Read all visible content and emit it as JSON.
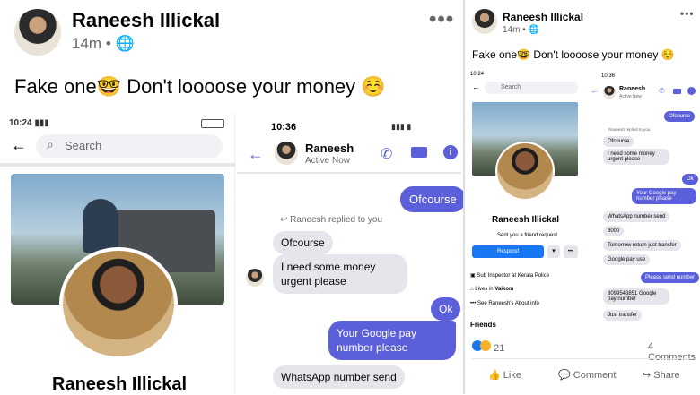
{
  "left_post": {
    "author": "Raneesh Illickal",
    "time": "14m",
    "caption": "Fake one",
    "caption_rest": "Don't loooose  your money",
    "emoji_nerd": "🤓",
    "emoji_smile": "☺️"
  },
  "left_phone_a": {
    "time": "10:24",
    "search_placeholder": "Search",
    "profile_name": "Raneesh Illickal"
  },
  "left_phone_b": {
    "time": "10:36",
    "contact_name": "Raneesh",
    "contact_status": "Active Now",
    "bubbles": {
      "ofcourse_out": "Ofcourse",
      "replied": "Raneesh replied to you",
      "ofcourse_in": "Ofcourse",
      "need_money": "I need some money urgent please",
      "ok": "Ok",
      "google_pay": "Your Google pay number please",
      "whatsapp": "WhatsApp number send"
    }
  },
  "right_post": {
    "author": "Raneesh Illickal",
    "time": "14m",
    "caption": "Fake one",
    "caption_rest": "Don't loooose  your money",
    "phone_a": {
      "time": "10:24",
      "search_placeholder": "Search",
      "profile_name": "Raneesh Illickal",
      "friend_request": "Sent you a friend request",
      "respond": "Respond",
      "work": "Sub Inspector at Kerala Police",
      "lives": "Lives in",
      "city": "Vaikom",
      "about": "See Raneesh's About info",
      "friends": "Friends"
    },
    "phone_b": {
      "time": "10:36",
      "contact_name": "Raneesh",
      "contact_status": "Active Now",
      "msgs": {
        "ofcourse_out": "Ofcourse",
        "replied": "Raneesh replied to you",
        "ofcourse_in": "Ofcourse",
        "need_money": "I need some money urgent please",
        "ok": "Ok",
        "google_pay": "Your Google pay number please",
        "whatsapp": "WhatsApp number send",
        "n8000": "8000",
        "tomorrow": "Tomorrow return just transfer",
        "gpay_use": "Google pay use",
        "send_number": "Please send number",
        "gpay_number": "8099543851 Google pay number",
        "just_transfer": "Just transfer"
      }
    },
    "reactions_count": "21",
    "comments_count": "4 Comments",
    "like_label": "Like",
    "comment_label": "Comment",
    "share_label": "Share"
  },
  "colors": {
    "accent": "#5b5fd9",
    "fb_blue": "#1877f2",
    "bubble_gray": "#e4e6eb"
  }
}
